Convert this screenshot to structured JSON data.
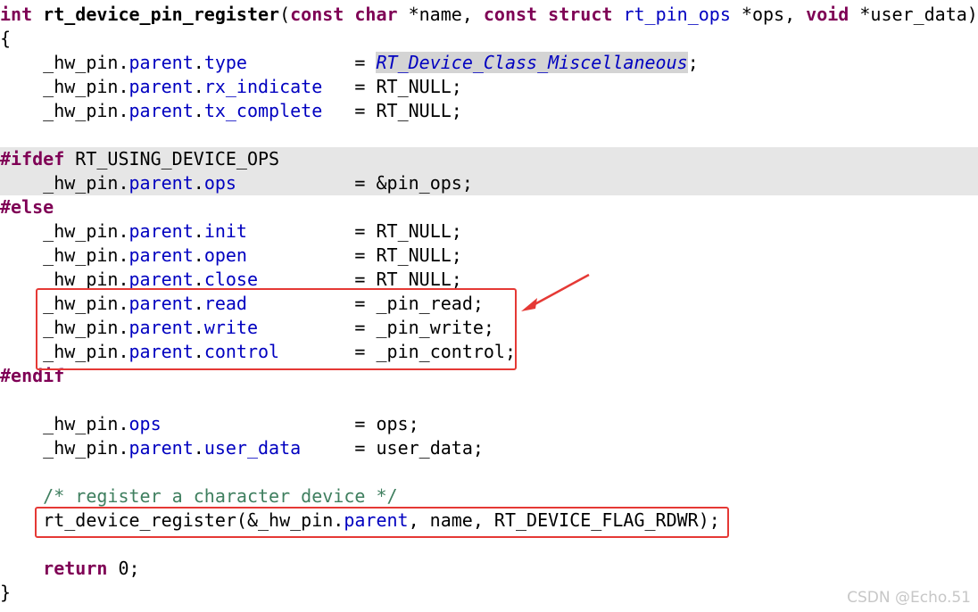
{
  "code": {
    "signature": {
      "ret_type": "int",
      "func_name": "rt_device_pin_register",
      "open_paren": "(",
      "kw_const1": "const",
      "kw_char": "char",
      "param1": " *name, ",
      "kw_const2": "const",
      "kw_struct": "struct",
      "type_ops": "rt_pin_ops",
      "param2": " *ops, ",
      "kw_void": "void",
      "param3": " *user_data)"
    },
    "open_brace": "{",
    "close_brace": "}",
    "hw_pin": "_hw_pin",
    "dot": ".",
    "parent": "parent",
    "lines": {
      "type_field": "type",
      "type_value": "RT_Device_Class_Miscellaneous",
      "rx_field": "rx_indicate",
      "tx_field": "tx_complete",
      "rt_null": "RT_NULL",
      "ifdef_kw": "#ifdef",
      "ifdef_macro": "RT_USING_DEVICE_OPS",
      "ops_field": "ops",
      "ops_value": "&pin_ops",
      "else_kw": "#else",
      "init_field": "init",
      "open_field": "open",
      "close_field": "close",
      "read_field": "read",
      "read_value": "_pin_read",
      "write_field": "write",
      "write_value": "_pin_write",
      "control_field": "control",
      "control_value": "_pin_control",
      "endif_kw": "#endif",
      "hwops_field": "ops",
      "hwops_value": "ops",
      "user_data_field": "user_data",
      "user_data_value": "user_data",
      "comment": "/* register a character device */",
      "register_call_fn": "rt_device_register",
      "register_call_arg1": "(&_hw_pin.",
      "register_call_arg2": ", name, RT_DEVICE_FLAG_RDWR);",
      "return_kw": "return",
      "return_value": " 0;"
    }
  },
  "annotations": {
    "box_color": "#e53935",
    "arrow_color": "#e53935"
  },
  "watermark": "CSDN @Echo.51"
}
